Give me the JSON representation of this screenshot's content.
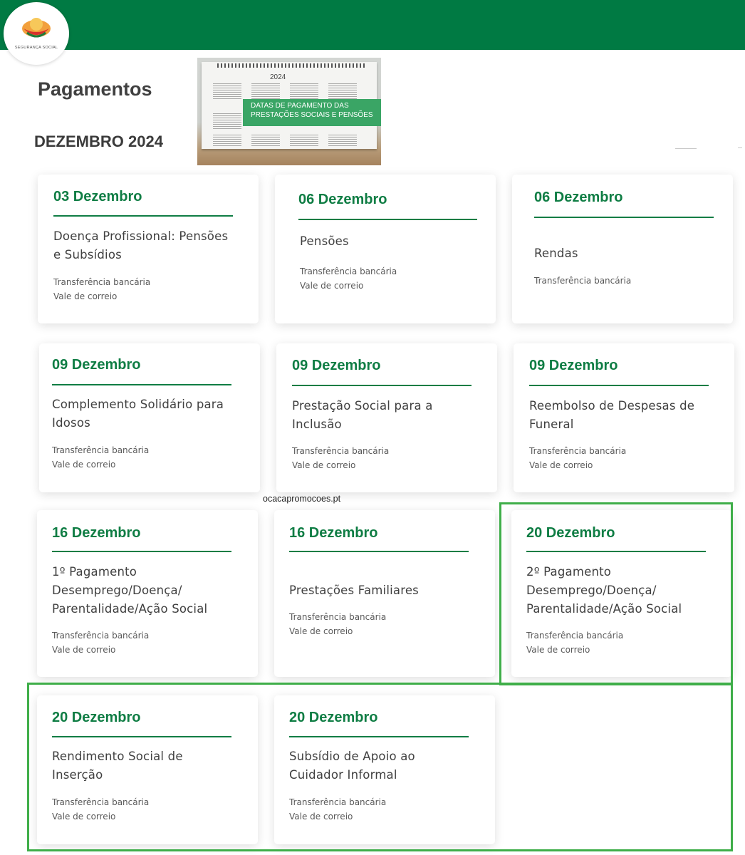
{
  "header": {
    "logo_text": "SEGURANÇA SOCIAL",
    "bar_color": "#007a43"
  },
  "page": {
    "title": "Pagamentos",
    "month": "DEZEMBRO 2024"
  },
  "banner": {
    "year": "2024",
    "line1": "DATAS DE PAGAMENTO DAS",
    "line2": "PRESTAÇÕES SOCIAIS E PENSÕES"
  },
  "watermark": "ocacapromocoes.pt",
  "colors": {
    "accent": "#0f7d44",
    "highlight": "#3fae49"
  },
  "cards": [
    {
      "date": "03 Dezembro",
      "title_lines": [
        "Doença Profissional: Pensões",
        "e Subsídios"
      ],
      "methods": [
        "Transferência bancária",
        "Vale de correio"
      ]
    },
    {
      "date": "06 Dezembro",
      "title_lines": [
        "Pensões"
      ],
      "methods": [
        "Transferência bancária",
        "Vale de correio"
      ]
    },
    {
      "date": "06 Dezembro",
      "title_lines": [
        "Rendas"
      ],
      "methods": [
        "Transferência bancária"
      ]
    },
    {
      "date": "09 Dezembro",
      "title_lines": [
        "Complemento Solidário para",
        "Idosos"
      ],
      "methods": [
        "Transferência bancária",
        "Vale de correio"
      ]
    },
    {
      "date": "09 Dezembro",
      "title_lines": [
        "Prestação Social para a",
        "Inclusão"
      ],
      "methods": [
        "Transferência bancária",
        "Vale de correio"
      ]
    },
    {
      "date": "09 Dezembro",
      "title_lines": [
        "Reembolso de Despesas de",
        "Funeral"
      ],
      "methods": [
        "Transferência bancária",
        "Vale de correio"
      ]
    },
    {
      "date": "16 Dezembro",
      "title_lines": [
        "1º Pagamento",
        "Desemprego/Doença/",
        "Parentalidade/Ação Social"
      ],
      "methods": [
        "Transferência bancária",
        "Vale de correio"
      ]
    },
    {
      "date": "16 Dezembro",
      "title_lines": [
        "Prestações Familiares"
      ],
      "methods": [
        "Transferência bancária",
        "Vale de correio"
      ]
    },
    {
      "date": "20 Dezembro",
      "title_lines": [
        "2º Pagamento",
        "Desemprego/Doença/",
        "Parentalidade/Ação Social"
      ],
      "methods": [
        "Transferência bancária",
        "Vale de correio"
      ]
    },
    {
      "date": "20 Dezembro",
      "title_lines": [
        "Rendimento Social de",
        "Inserção"
      ],
      "methods": [
        "Transferência bancária",
        "Vale de correio"
      ]
    },
    {
      "date": "20 Dezembro",
      "title_lines": [
        "Subsídio de Apoio ao",
        "Cuidador Informal"
      ],
      "methods": [
        "Transferência bancária",
        "Vale de correio"
      ]
    }
  ]
}
